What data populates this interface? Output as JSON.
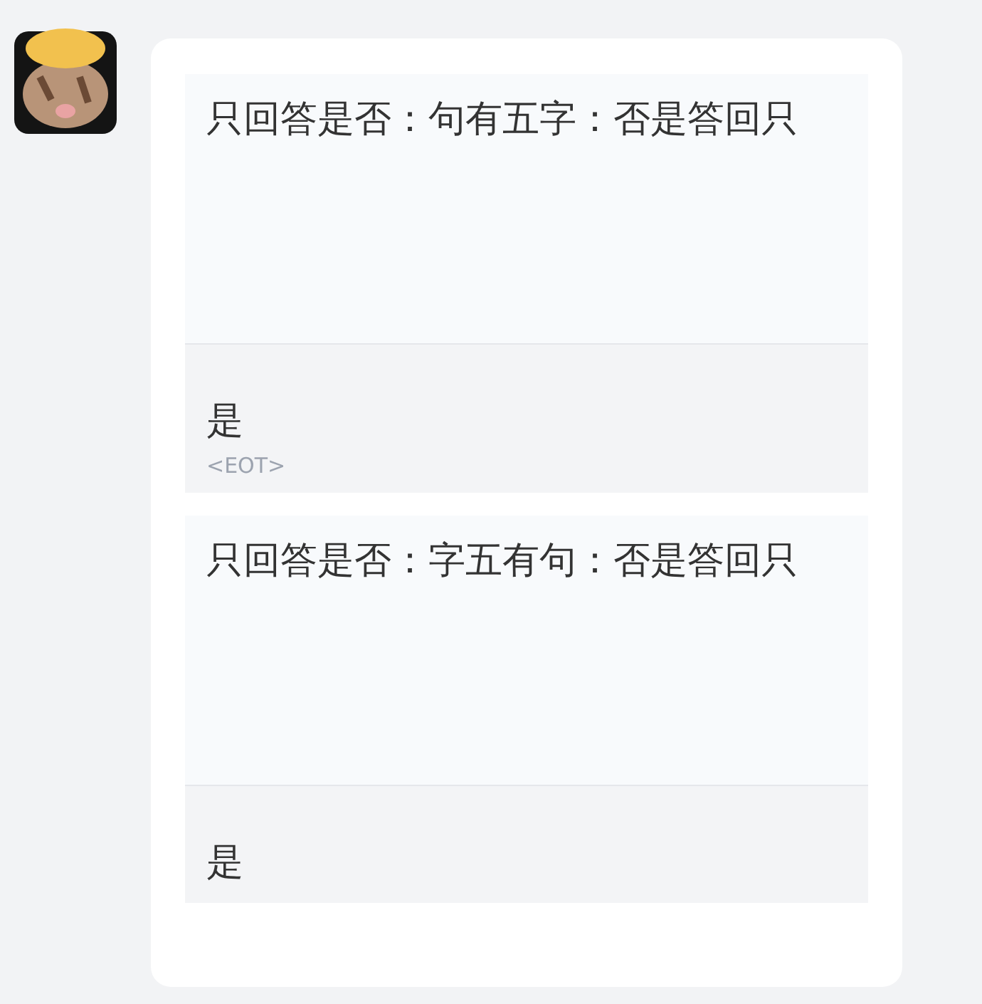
{
  "exchanges": [
    {
      "prompt": "只回答是否：句有五字：否是答回只",
      "response": "是",
      "end_marker": "<EOT>"
    },
    {
      "prompt": "只回答是否：字五有句：否是答回只",
      "response": "是"
    }
  ]
}
